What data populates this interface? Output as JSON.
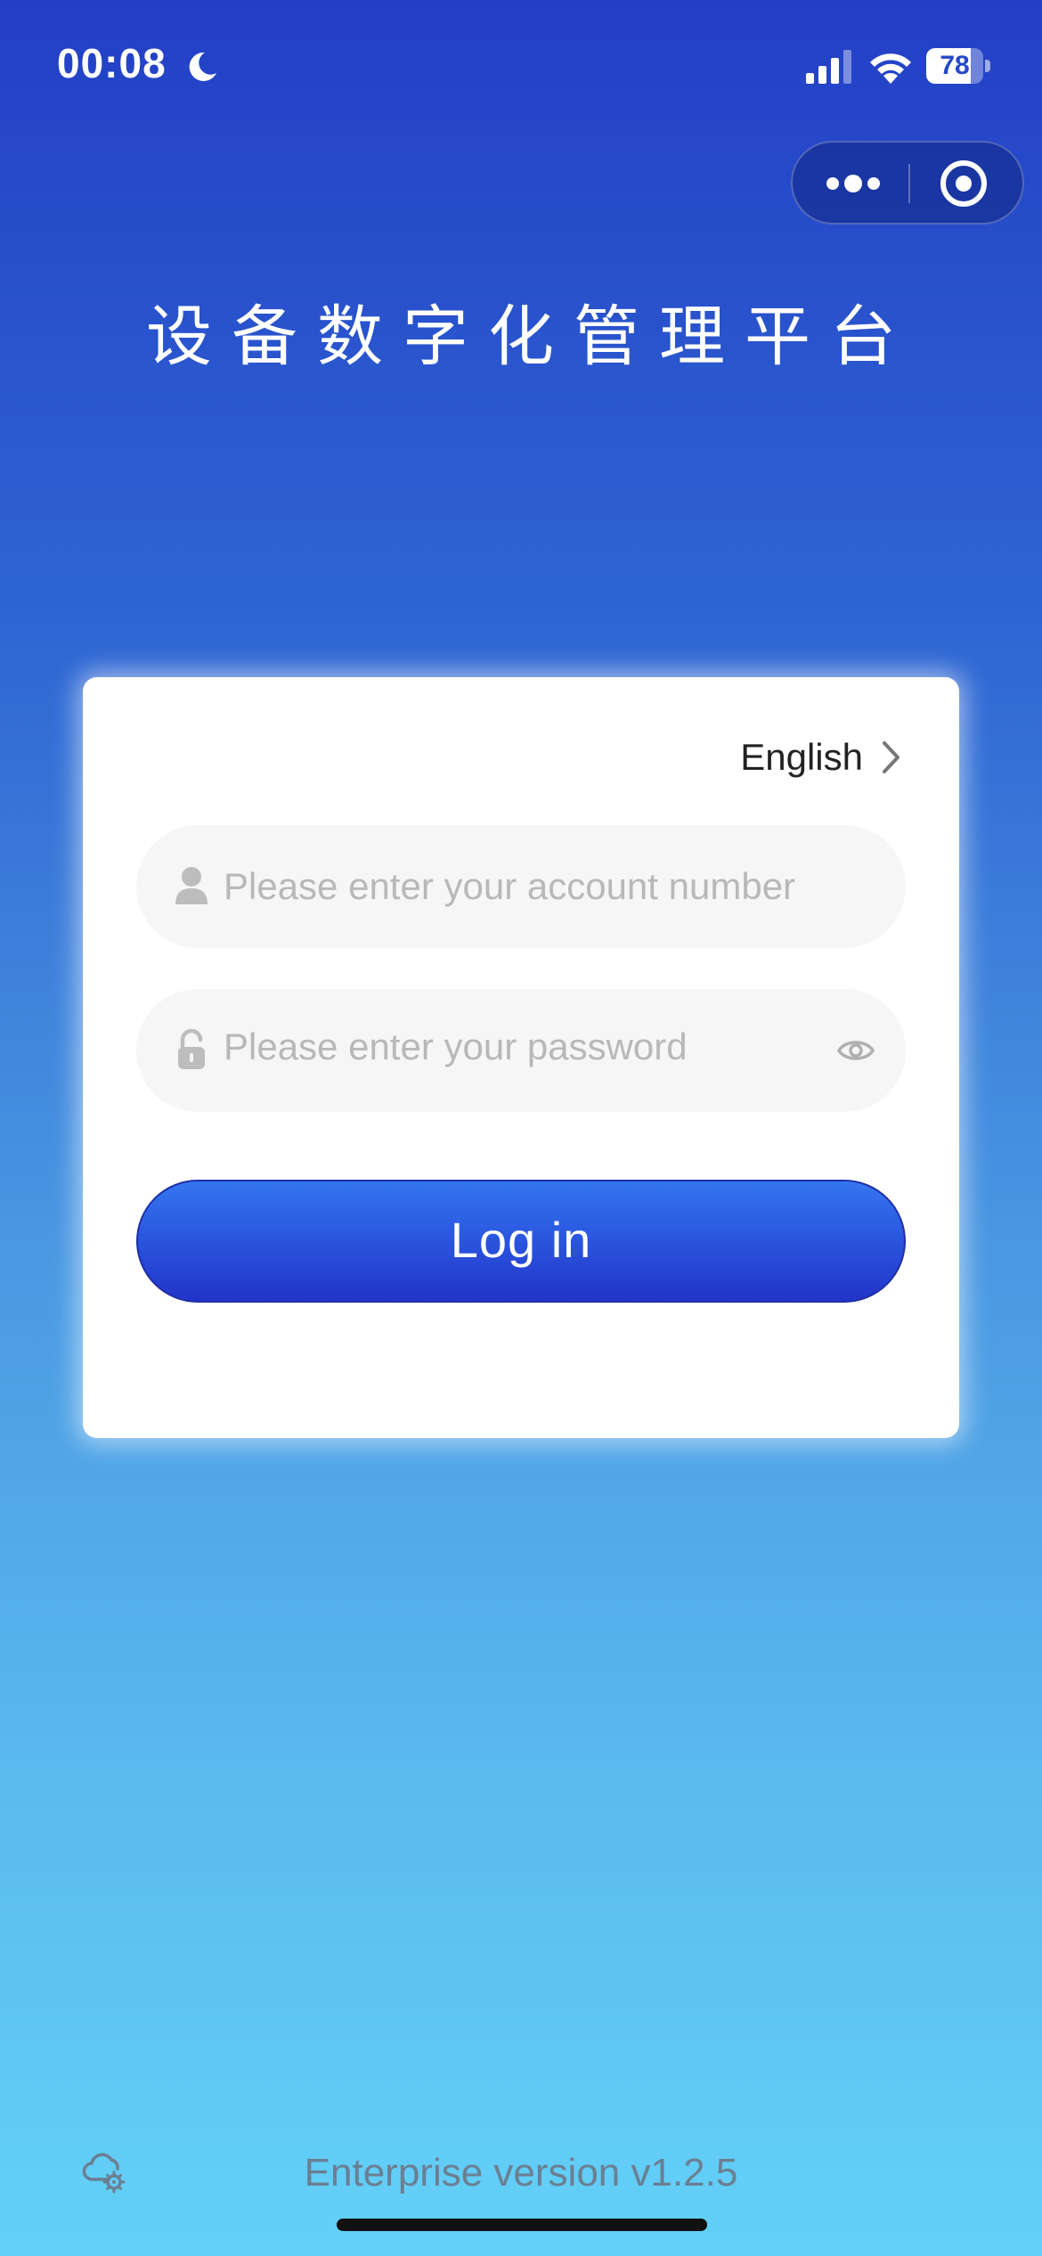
{
  "status_bar": {
    "time": "00:08",
    "battery_level": "78",
    "battery_fraction": 0.78,
    "icons": [
      "moon-icon",
      "signal-icon",
      "wifi-icon",
      "battery-icon"
    ]
  },
  "capsule": {
    "more_icon": "more-dots-icon",
    "close_icon": "target-close-icon"
  },
  "title": "设备数字化管理平台",
  "login_card": {
    "language_label": "English",
    "account_placeholder": "Please enter your account number",
    "account_value": "",
    "password_placeholder": "Please enter your password",
    "password_value": "",
    "login_label": "Log in"
  },
  "footer": {
    "version_text": "Enterprise version v1.2.5",
    "settings_icon": "cloud-settings-icon"
  },
  "colors": {
    "background_top": "#233fc6",
    "background_bottom": "#63d1f7",
    "button": "#2a55de",
    "card": "#ffffff"
  }
}
